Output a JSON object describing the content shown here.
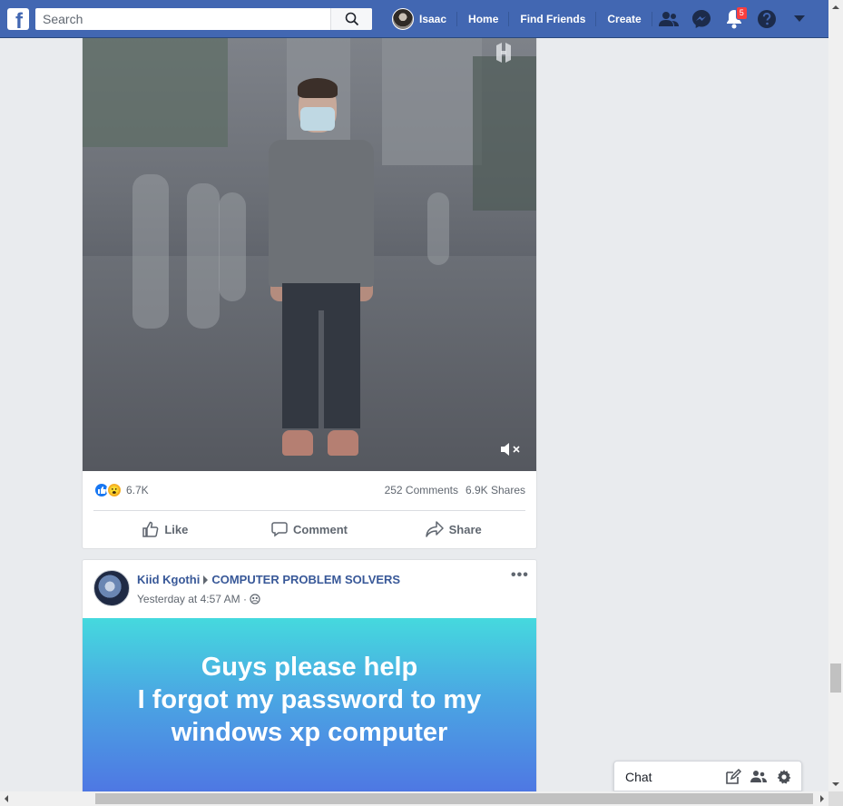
{
  "topbar": {
    "logo_letter": "f",
    "search_placeholder": "Search",
    "profile_name": "Isaac",
    "nav": [
      "Home",
      "Find Friends",
      "Create"
    ],
    "notification_count": "5",
    "accent": "#4267b2"
  },
  "post1": {
    "reaction_count": "6.7K",
    "comments": "252 Comments",
    "shares": "6.9K Shares",
    "actions": {
      "like": "Like",
      "comment": "Comment",
      "share": "Share"
    }
  },
  "post2": {
    "author": "Kiid Kgothi",
    "group": "COMPUTER PROBLEM SOLVERS",
    "timestamp": "Yesterday at 4:57 AM ·",
    "text_lines": [
      "Guys please help",
      "I forgot my password to my",
      "windows xp computer"
    ]
  },
  "chat": {
    "label": "Chat"
  }
}
